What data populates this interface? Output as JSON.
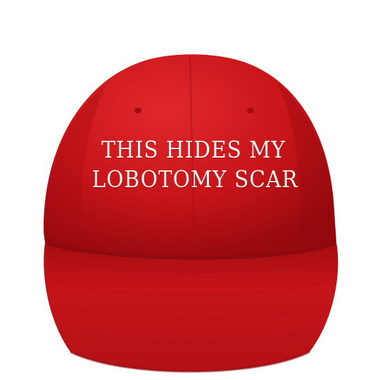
{
  "cap": {
    "color": "#c8151a",
    "shadow_color": "#8e0a0e",
    "highlight_color": "#e22a2a",
    "text_color": "#f4f1ee"
  },
  "embroidery": {
    "line1": "THIS HIDES MY",
    "line2": "LOBOTOMY SCAR"
  }
}
